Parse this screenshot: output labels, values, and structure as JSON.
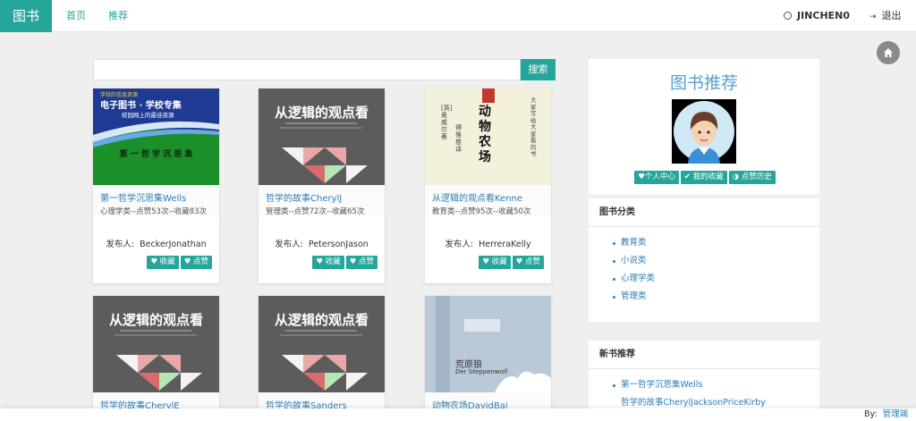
{
  "header": {
    "brand": "图书",
    "nav": [
      "首页",
      "推荐"
    ],
    "username": "JINCHEN0",
    "logout": "退出"
  },
  "search": {
    "button": "搜索",
    "placeholder": ""
  },
  "books": [
    {
      "title": "第一哲学沉思集Wells",
      "meta": "心理学类--点赞53次--收藏83次",
      "publisher_label": "发布人:",
      "publisher": "BeckerJonathan",
      "collect": "收藏",
      "like": "点赞",
      "cover": {
        "top": "学校的信息资源",
        "line1": "电子图书 · 学校专集",
        "line2": "校园网上的最佳资源",
        "band": "第 一 哲 学 沉 思 集"
      }
    },
    {
      "title": "哲学的故事CherylJ",
      "meta": "管理类--点赞72次--收藏65次",
      "publisher_label": "发布人:",
      "publisher": "PetersonJason",
      "collect": "收藏",
      "like": "点赞",
      "cover": {
        "title": "从逻辑的观点看"
      }
    },
    {
      "title": "从逻辑的观点看Kenne",
      "meta": "教育类--点赞95次--收藏50次",
      "publisher_label": "发布人:",
      "publisher": "HerreraKelly",
      "collect": "收藏",
      "like": "点赞",
      "cover": {
        "title": "动物农场",
        "author": "[英] 奥威尔 著",
        "translator": "傅惟慈 译",
        "side": "大家写给大家看的书"
      }
    },
    {
      "title": "哲学的故事CherylE",
      "cover": {
        "title": "从逻辑的观点看"
      }
    },
    {
      "title": "哲学的故事Sanders",
      "cover": {
        "title": "从逻辑的观点看"
      }
    },
    {
      "title": "动物农场DavidBai",
      "cover": {
        "title": "荒原狼",
        "subtitle": "Der Steppenwolf"
      }
    }
  ],
  "sidebar": {
    "rec_title": "图书推荐",
    "buttons": [
      "个人中心",
      "我的收藏",
      "点赞历史"
    ],
    "categories_title": "图书分类",
    "categories": [
      "教育类",
      "小说类",
      "心理学类",
      "管理类"
    ],
    "new_title": "新书推荐",
    "new_books": [
      "第一哲学沉思集Wells",
      "哲学的故事CherylJacksonPriceKirby"
    ]
  },
  "footer": {
    "by": "By:",
    "admin": "管理端"
  },
  "colors": {
    "accent": "#26a69a",
    "link": "#2c7db8",
    "title_blue": "#5aa0cf"
  },
  "icons": [
    "user-icon",
    "logout-icon",
    "home-icon",
    "heart-icon",
    "thumbs-up-icon",
    "history-icon"
  ]
}
